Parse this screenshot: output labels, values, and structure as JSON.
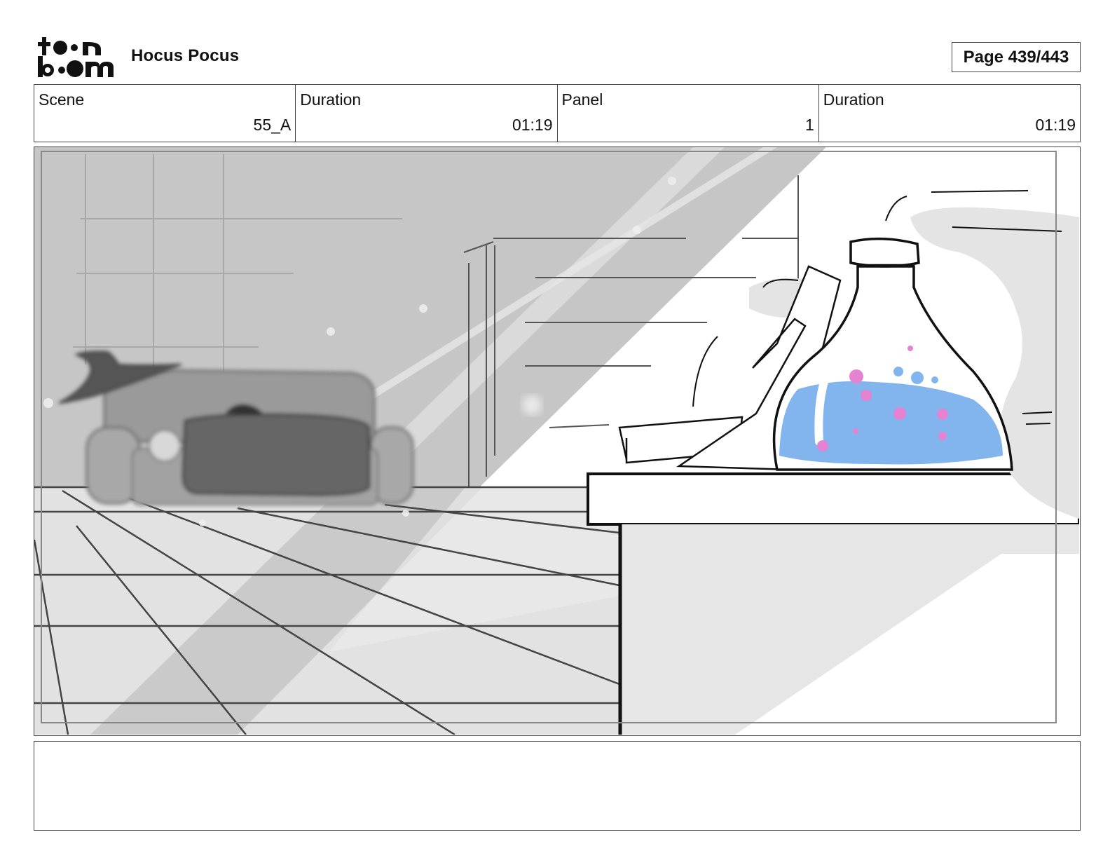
{
  "header": {
    "logo_text": "toonboom",
    "project_title": "Hocus Pocus",
    "page_label": "Page 439/443"
  },
  "info": {
    "scene_label": "Scene",
    "scene_value": "55_A",
    "scene_duration_label": "Duration",
    "scene_duration_value": "01:19",
    "panel_label": "Panel",
    "panel_value": "1",
    "panel_duration_label": "Duration",
    "panel_duration_value": "01:19"
  },
  "notes": {
    "text": ""
  },
  "colors": {
    "potion": "#82b4ee",
    "bubbles": "#e682d2"
  }
}
